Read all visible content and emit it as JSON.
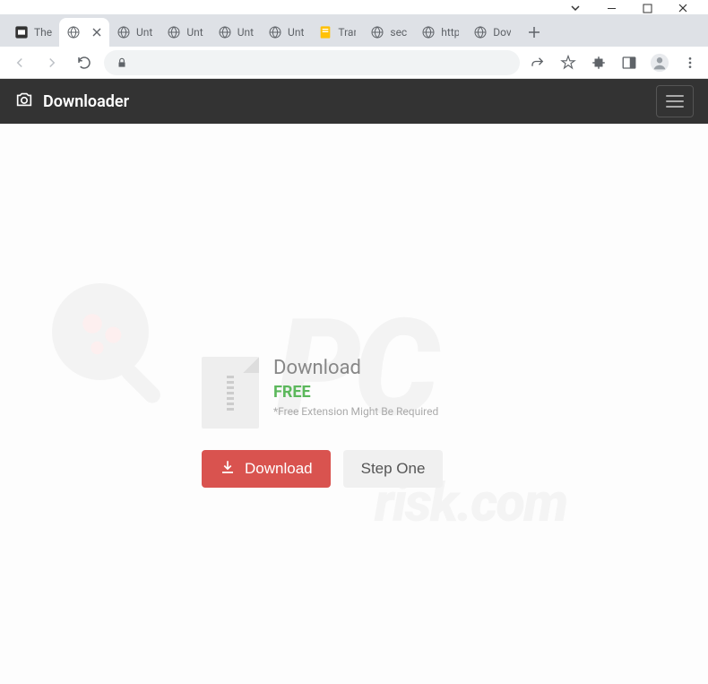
{
  "window": {
    "tabs": [
      {
        "title": "The",
        "favicon": "app-icon"
      },
      {
        "title": "",
        "favicon": "globe-icon",
        "active": true
      },
      {
        "title": "Unt",
        "favicon": "globe-icon"
      },
      {
        "title": "Unt",
        "favicon": "globe-icon"
      },
      {
        "title": "Unt",
        "favicon": "globe-icon"
      },
      {
        "title": "Unt",
        "favicon": "globe-icon"
      },
      {
        "title": "Trar",
        "favicon": "doc-icon"
      },
      {
        "title": "sec",
        "favicon": "globe-icon"
      },
      {
        "title": "http",
        "favicon": "globe-icon"
      },
      {
        "title": "Dov",
        "favicon": "globe-icon"
      }
    ]
  },
  "header": {
    "brand": "Downloader"
  },
  "page": {
    "title": "Download",
    "free_label": "FREE",
    "note": "*Free Extension Might Be Required",
    "download_button": "Download",
    "step_button": "Step One"
  },
  "watermark": {
    "main": "PC",
    "sub": "risk.com"
  }
}
